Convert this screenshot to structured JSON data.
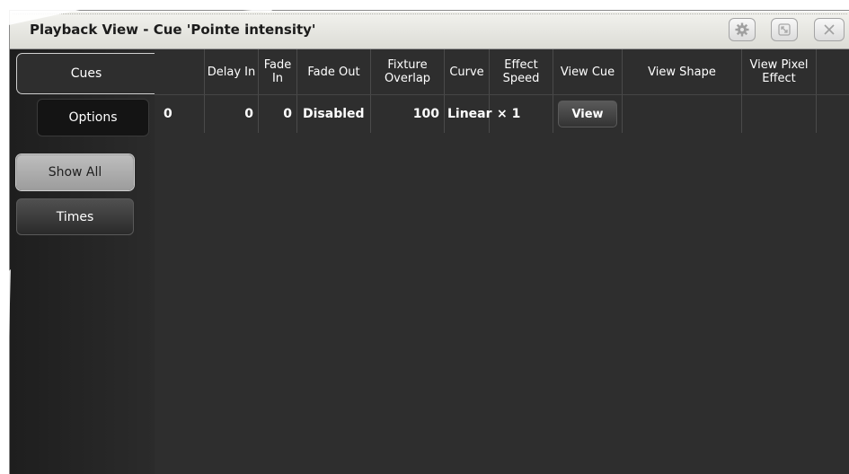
{
  "window": {
    "title": "Playback View - Cue 'Pointe intensity'",
    "buttons": [
      {
        "icon": "gear-icon"
      },
      {
        "icon": "resize-icon"
      },
      {
        "icon": "close-icon"
      }
    ]
  },
  "sidebar": {
    "tabs": [
      {
        "label": "Cues",
        "active": true
      },
      {
        "label": "Options",
        "active": false
      }
    ],
    "filters": [
      {
        "label": "Show All",
        "active": true
      },
      {
        "label": "Times",
        "active": false
      }
    ]
  },
  "table": {
    "columns": [
      "",
      "Delay In",
      "Fade In",
      "Fade Out",
      "Fixture Overlap",
      "Curve",
      "Effect Speed",
      "View Cue",
      "View Shape",
      "View Pixel Effect",
      ""
    ],
    "rows": [
      {
        "id": "0",
        "delay_in": "0",
        "fade_in": "0",
        "fade_out": "Disabled",
        "fixture_overlap": "100",
        "curve": "Linear",
        "effect_speed": "× 1",
        "view_cue_button": "View",
        "view_shape": "",
        "view_pixel_effect": ""
      }
    ]
  },
  "colors": {
    "background": "#2e2e2e",
    "titlebar": "#dcdcd6",
    "active_filter": "#b0b0b0"
  }
}
